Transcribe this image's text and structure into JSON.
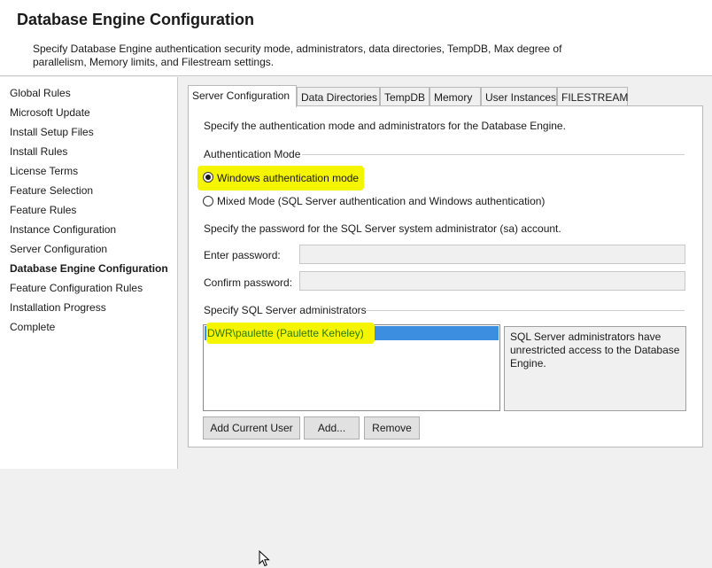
{
  "header": {
    "title": "Database Engine Configuration",
    "description": "Specify Database Engine authentication security mode, administrators, data directories, TempDB, Max degree of parallelism, Memory limits, and Filestream settings."
  },
  "sidebar": {
    "items": [
      {
        "label": "Global Rules"
      },
      {
        "label": "Microsoft Update"
      },
      {
        "label": "Install Setup Files"
      },
      {
        "label": "Install Rules"
      },
      {
        "label": "License Terms"
      },
      {
        "label": "Feature Selection"
      },
      {
        "label": "Feature Rules"
      },
      {
        "label": "Instance Configuration"
      },
      {
        "label": "Server Configuration"
      },
      {
        "label": "Database Engine Configuration"
      },
      {
        "label": "Feature Configuration Rules"
      },
      {
        "label": "Installation Progress"
      },
      {
        "label": "Complete"
      }
    ],
    "active_item": "Database Engine Configuration"
  },
  "tabs": [
    {
      "label": "Server Configuration"
    },
    {
      "label": "Data Directories"
    },
    {
      "label": "TempDB"
    },
    {
      "label": "Memory"
    },
    {
      "label": "User Instances"
    },
    {
      "label": "FILESTREAM"
    }
  ],
  "active_tab": "Server Configuration",
  "panel": {
    "intro": "Specify the authentication mode and administrators for the Database Engine.",
    "auth_group_label": "Authentication Mode",
    "auth_options": [
      {
        "label": "Windows authentication mode",
        "selected": true
      },
      {
        "label": "Mixed Mode (SQL Server authentication and Windows authentication)",
        "selected": false
      }
    ],
    "password_intro": "Specify the password for the SQL Server system administrator (sa) account.",
    "enter_password_label": "Enter password:",
    "enter_password_value": "",
    "confirm_password_label": "Confirm password:",
    "confirm_password_value": "",
    "admins_group_label": "Specify SQL Server administrators",
    "admins": [
      {
        "name": "DWR\\paulette (Paulette Keheley)",
        "selected": true
      }
    ],
    "admins_info": "SQL Server administrators have unrestricted access to the Database Engine.",
    "buttons": {
      "add_current_user": "Add Current User",
      "add": "Add...",
      "remove": "Remove"
    }
  },
  "colors": {
    "highlight": "#f5f500",
    "selection": "#3c8ee0",
    "selected_text": "#2a7a10"
  }
}
